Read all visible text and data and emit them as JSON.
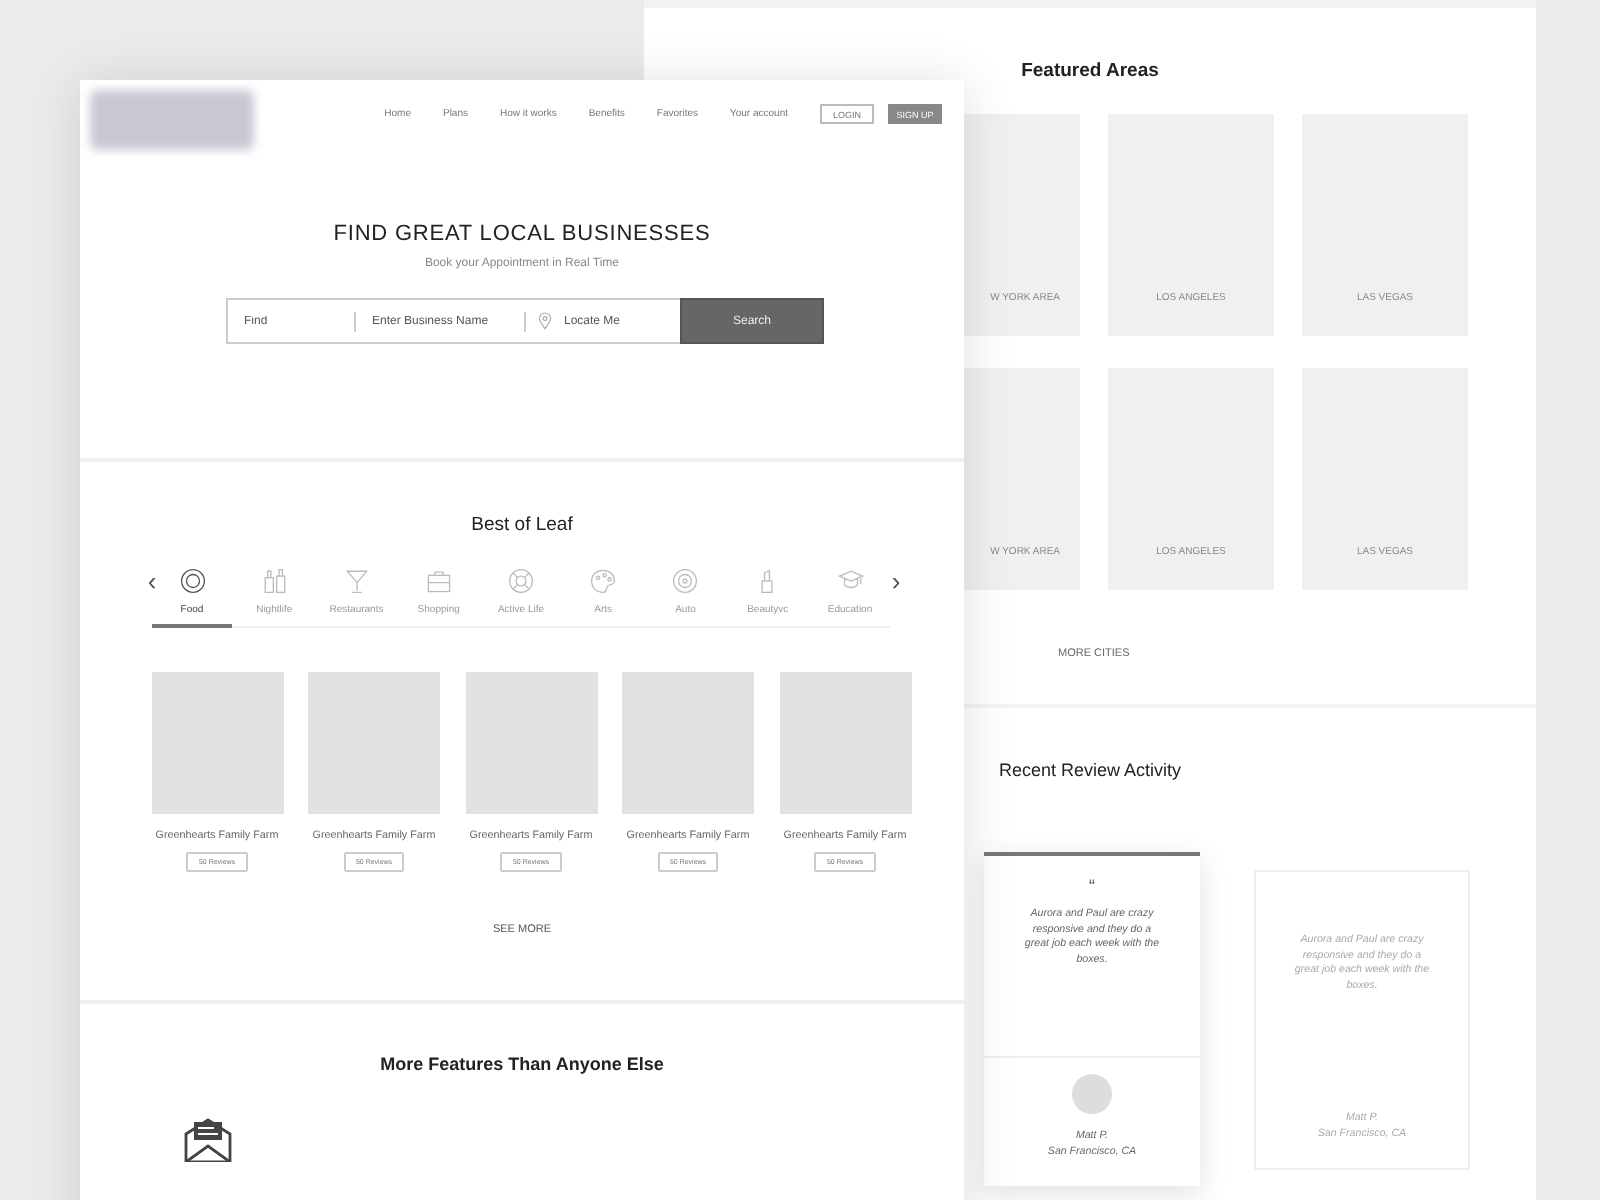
{
  "back_page": {
    "featured_areas": {
      "title": "Featured Areas",
      "rows": [
        {
          "areas": [
            "W YORK AREA",
            "LOS ANGELES",
            "LAS VEGAS"
          ]
        },
        {
          "areas": [
            "W YORK AREA",
            "LOS ANGELES",
            "LAS VEGAS"
          ]
        }
      ],
      "more_link": "MORE CITIES"
    },
    "recent_reviews": {
      "title": "Recent Review Activity",
      "cards": [
        {
          "kind": "featured",
          "quote_mark": "“",
          "text": "Aurora and Paul are crazy responsive and they do a great job each week with the boxes.",
          "author": "Matt P.",
          "location": "San Francisco, CA"
        },
        {
          "kind": "plain",
          "text": "Aurora and Paul are crazy responsive and they do a great job each week with the boxes.",
          "author": "Matt P.",
          "location": "San Francisco, CA"
        }
      ]
    }
  },
  "front_page": {
    "nav": {
      "links": [
        "Home",
        "Plans",
        "How it works",
        "Benefits",
        "Favorites",
        "Your account"
      ],
      "login": "LOGIN",
      "signup": "SIGN UP"
    },
    "hero": {
      "title": "FIND GREAT LOCAL BUSINESSES",
      "subtitle": "Book your Appointment in Real Time",
      "search": {
        "find_placeholder": "Find",
        "business_placeholder": "Enter Business Name",
        "location_placeholder": "Locate Me",
        "button": "Search"
      }
    },
    "best_of": {
      "title": "Best of Leaf",
      "prev": "‹",
      "next": "›",
      "categories": [
        {
          "label": "Food",
          "selected": true
        },
        {
          "label": "Nightlife",
          "selected": false
        },
        {
          "label": "Restaurants",
          "selected": false
        },
        {
          "label": "Shopping",
          "selected": false
        },
        {
          "label": "Active Life",
          "selected": false
        },
        {
          "label": "Arts",
          "selected": false
        },
        {
          "label": "Auto",
          "selected": false
        },
        {
          "label": "Beautyvc",
          "selected": false
        },
        {
          "label": "Education",
          "selected": false
        }
      ],
      "businesses": [
        {
          "name": "Greenhearts Family Farm",
          "reviews": "50 Reviews"
        },
        {
          "name": "Greenhearts Family Farm",
          "reviews": "50 Reviews"
        },
        {
          "name": "Greenhearts Family Farm",
          "reviews": "50 Reviews"
        },
        {
          "name": "Greenhearts Family Farm",
          "reviews": "50 Reviews"
        },
        {
          "name": "Greenhearts Family Farm",
          "reviews": "50 Reviews"
        }
      ],
      "see_more": "SEE MORE"
    },
    "features": {
      "title": "More Features Than Anyone Else"
    }
  }
}
